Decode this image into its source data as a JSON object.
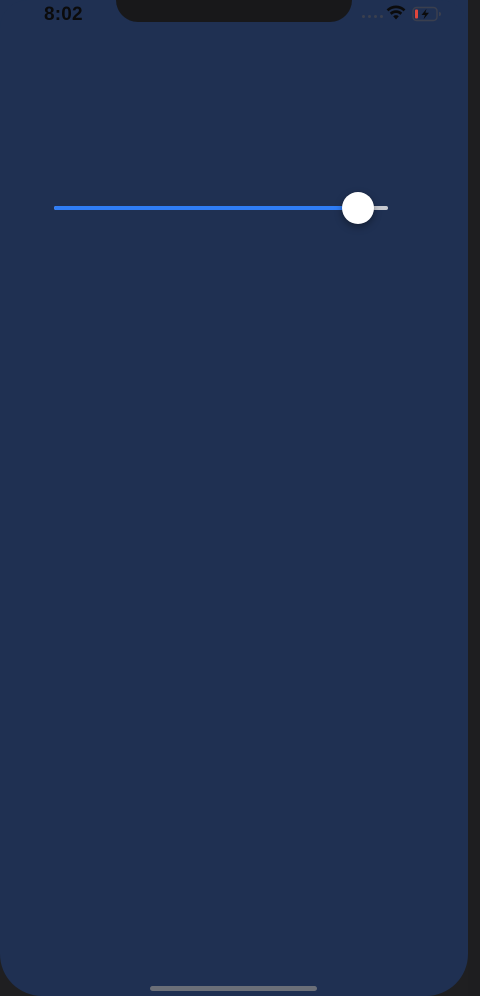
{
  "status_bar": {
    "time": "8:02",
    "icons": [
      "signal-dots-icon",
      "wifi-icon",
      "battery-charging-icon"
    ]
  },
  "slider": {
    "value": 0.91,
    "min": 0,
    "max": 1
  },
  "colors": {
    "background": "#1f3052",
    "track_active": "#2f7df6",
    "track_inactive": "#c7c9cf",
    "thumb": "#ffffff",
    "battery_low": "#e0463c"
  }
}
